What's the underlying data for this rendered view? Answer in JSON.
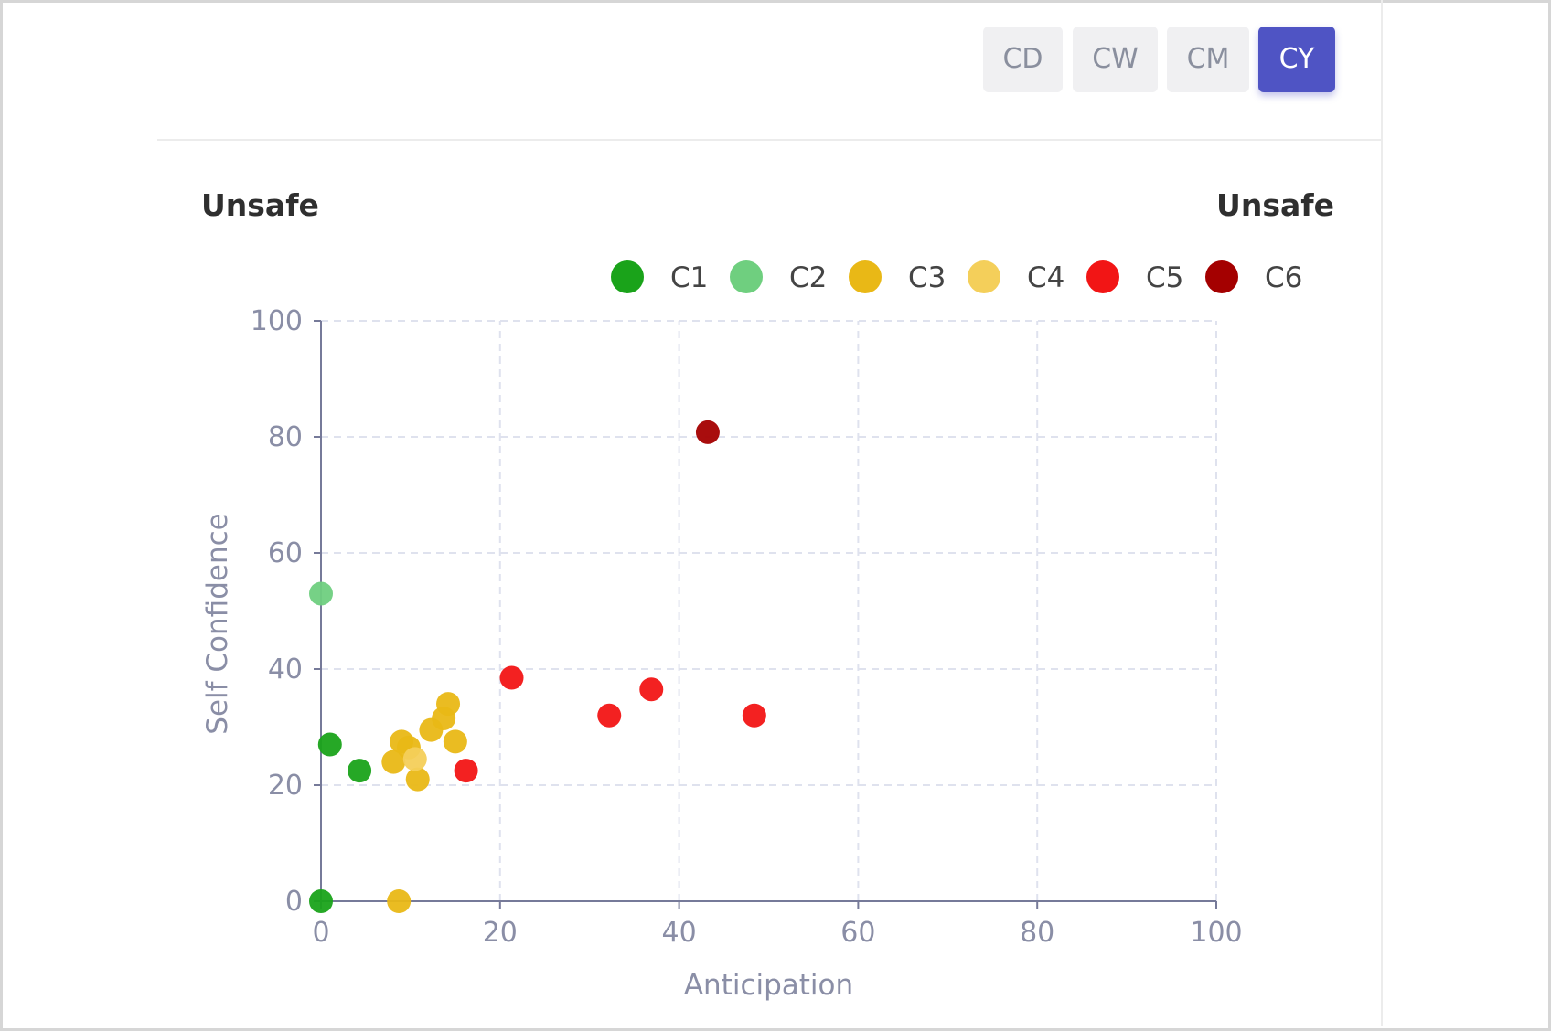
{
  "toolbar": {
    "buttons": [
      {
        "label": "CD",
        "active": false
      },
      {
        "label": "CW",
        "active": false
      },
      {
        "label": "CM",
        "active": false
      },
      {
        "label": "CY",
        "active": true
      }
    ]
  },
  "header": {
    "left_label": "Unsafe",
    "right_label": "Unsafe"
  },
  "colors": {
    "C1": "#1aa31a",
    "C2": "#6fcf7f",
    "C3": "#e9b816",
    "C4": "#f4cf5a",
    "C5": "#f21515",
    "C6": "#a40000",
    "axis": "#767a99",
    "grid": "#dfe2ee",
    "tick_text": "#8a8ea6"
  },
  "chart_data": {
    "type": "scatter",
    "title": "",
    "xlabel": "Anticipation",
    "ylabel": "Self Confidence",
    "xlim": [
      0,
      100
    ],
    "ylim": [
      0,
      100
    ],
    "xticks": [
      0,
      20,
      40,
      60,
      80,
      100
    ],
    "yticks": [
      0,
      20,
      40,
      60,
      80,
      100
    ],
    "grid": true,
    "legend_position": "top-right",
    "legend": [
      "C1",
      "C2",
      "C3",
      "C4",
      "C5",
      "C6"
    ],
    "series": [
      {
        "name": "C1",
        "points": [
          [
            0,
            0
          ],
          [
            1,
            27
          ],
          [
            4.3,
            22.5
          ]
        ]
      },
      {
        "name": "C2",
        "points": [
          [
            0,
            53
          ]
        ]
      },
      {
        "name": "C3",
        "points": [
          [
            8.7,
            0
          ],
          [
            8.1,
            24
          ],
          [
            9,
            27.5
          ],
          [
            9.8,
            26.5
          ],
          [
            10.8,
            21
          ],
          [
            12.3,
            29.5
          ],
          [
            13.7,
            31.5
          ],
          [
            14.2,
            34
          ],
          [
            15,
            27.5
          ]
        ]
      },
      {
        "name": "C4",
        "points": [
          [
            10.5,
            24.5
          ]
        ]
      },
      {
        "name": "C5",
        "points": [
          [
            16.2,
            22.5
          ],
          [
            21.3,
            38.5
          ],
          [
            32.2,
            32
          ],
          [
            36.9,
            36.5
          ],
          [
            48.4,
            32
          ]
        ]
      },
      {
        "name": "C6",
        "points": [
          [
            43.2,
            80.8
          ]
        ]
      }
    ]
  }
}
